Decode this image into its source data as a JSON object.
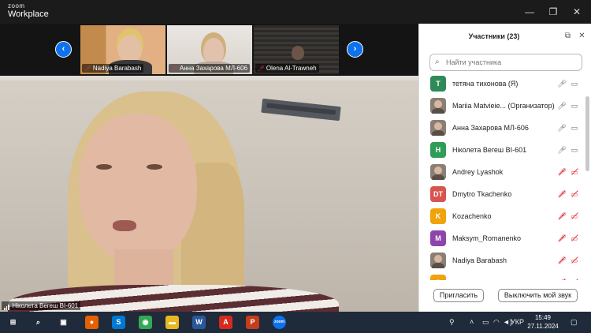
{
  "app": {
    "logo_line1": "zoom",
    "logo_line2": "Workplace"
  },
  "window_controls": {
    "minimize": "—",
    "restore": "❐",
    "close": "✕"
  },
  "thumbnails": [
    {
      "name": "Nadiya Barabash"
    },
    {
      "name": "Анна Захарова МЛ-606"
    },
    {
      "name": "Olena Al-Trawneh"
    }
  ],
  "main_video": {
    "speaker_name": "Ніколета Вегеш ВІ-601"
  },
  "panel": {
    "title": "Участники (23)",
    "search_placeholder": "Найти участника",
    "invite_label": "Пригласить",
    "mute_label": "Выключить мой звук"
  },
  "participants": [
    {
      "initial": "Т",
      "color": "#2e8b57",
      "photo": false,
      "name": "тетяна тихонова (Я)",
      "mic": "on",
      "cam": "on"
    },
    {
      "initial": "",
      "color": "#8a7f74",
      "photo": true,
      "name": "Mariia Matvieie... (Организатор)",
      "mic": "on",
      "cam": "on"
    },
    {
      "initial": "",
      "color": "#8a7f74",
      "photo": true,
      "name": "Анна Захарова МЛ-606",
      "mic": "on",
      "cam": "on"
    },
    {
      "initial": "Н",
      "color": "#2e9e56",
      "photo": false,
      "name": "Ніколета Вегеш ВІ-601",
      "mic": "on",
      "cam": "on"
    },
    {
      "initial": "",
      "color": "#8a7f74",
      "photo": true,
      "name": "Andrey Lyashok",
      "mic": "off",
      "cam": "off"
    },
    {
      "initial": "DT",
      "color": "#d9534f",
      "photo": false,
      "name": "Dmytro Tkachenko",
      "mic": "off",
      "cam": "off"
    },
    {
      "initial": "K",
      "color": "#f0a30a",
      "photo": false,
      "name": "Kozachenko",
      "mic": "off",
      "cam": "off"
    },
    {
      "initial": "M",
      "color": "#8e44ad",
      "photo": false,
      "name": "Maksym_Romanenko",
      "mic": "off",
      "cam": "off"
    },
    {
      "initial": "",
      "color": "#8a7f74",
      "photo": true,
      "name": "Nadiya Barabash",
      "mic": "off",
      "cam": "off"
    },
    {
      "initial": "O",
      "color": "#f0a30a",
      "photo": false,
      "name": "",
      "mic": "off",
      "cam": "off"
    }
  ],
  "taskbar": {
    "lang": "УКР",
    "time": "15:49",
    "date": "27.11.2024",
    "apps": [
      {
        "name": "start",
        "glyph": "⊞",
        "color": "#1f2a3a"
      },
      {
        "name": "search",
        "glyph": "⌕",
        "color": "#1f2a3a"
      },
      {
        "name": "task-view",
        "glyph": "▣",
        "color": "#1f2a3a"
      },
      {
        "name": "firefox",
        "glyph": "●",
        "color": "#e66000"
      },
      {
        "name": "skype",
        "glyph": "S",
        "color": "#0078d4"
      },
      {
        "name": "chrome",
        "glyph": "◉",
        "color": "#34a853"
      },
      {
        "name": "explorer",
        "glyph": "▬",
        "color": "#e8b820"
      },
      {
        "name": "word",
        "glyph": "W",
        "color": "#2b579a"
      },
      {
        "name": "acrobat",
        "glyph": "A",
        "color": "#d52b1e"
      },
      {
        "name": "powerpoint",
        "glyph": "P",
        "color": "#c43e1c"
      },
      {
        "name": "zoom",
        "glyph": "zoom",
        "color": "#0e72ed"
      }
    ]
  }
}
